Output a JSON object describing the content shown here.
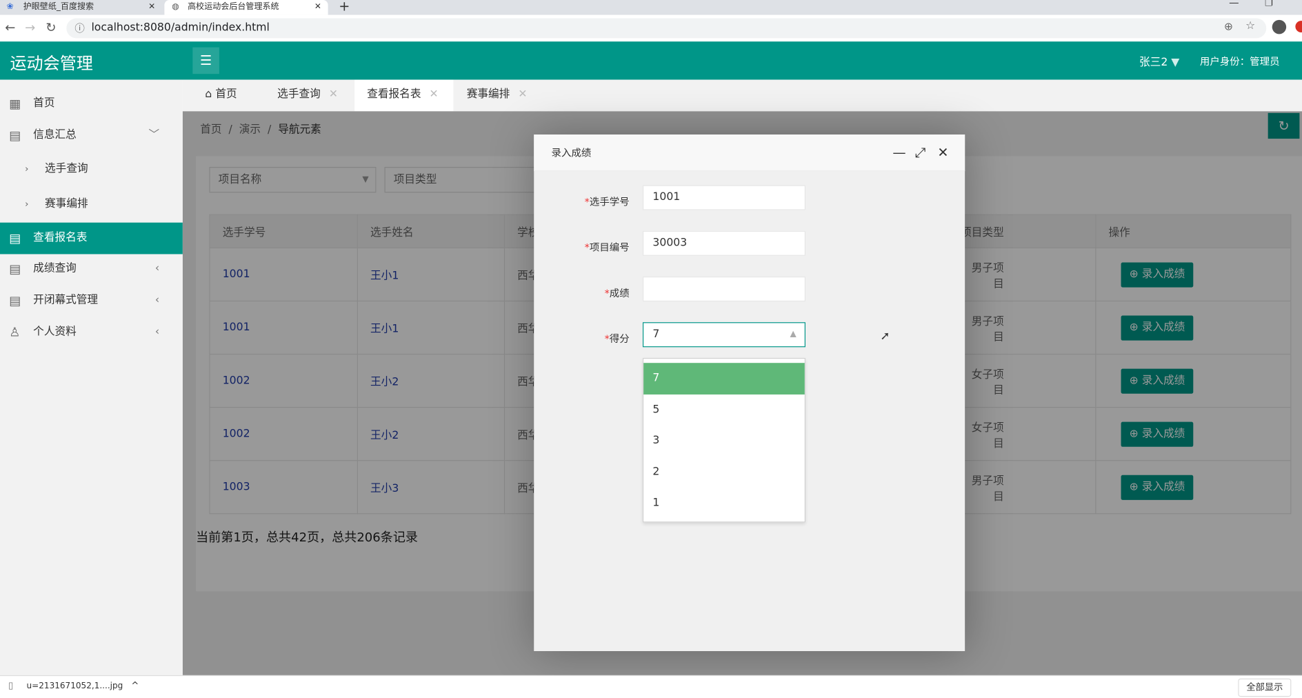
{
  "browser": {
    "tabs": [
      {
        "title": "护眼壁纸_百度搜索",
        "active": false
      },
      {
        "title": "高校运动会后台管理系统",
        "active": true
      }
    ],
    "url": "localhost:8080/admin/index.html"
  },
  "header": {
    "logo": "运动会管理",
    "user": "张三2",
    "role": "用户身份：管理员",
    "accent": "#009688"
  },
  "sidebar": {
    "items": [
      {
        "label": "首页",
        "icon": "grid-icon"
      },
      {
        "label": "信息汇总",
        "icon": "doc-icon",
        "expanded": true
      },
      {
        "label": "选手查询",
        "sub": true
      },
      {
        "label": "赛事编排",
        "sub": true
      },
      {
        "label": "查看报名表",
        "icon": "doc-icon",
        "active": true
      },
      {
        "label": "成绩查询",
        "icon": "edit-icon"
      },
      {
        "label": "开闭幕式管理",
        "icon": "doc-icon"
      },
      {
        "label": "个人资料",
        "icon": "user-icon"
      }
    ]
  },
  "page_tabs": [
    {
      "label": "首页"
    },
    {
      "label": "选手查询"
    },
    {
      "label": "查看报名表",
      "active": true
    },
    {
      "label": "赛事编排"
    }
  ],
  "breadcrumb": [
    "首页",
    "演示",
    "导航元素"
  ],
  "filters": {
    "project_name": "项目名称",
    "project_type": "项目类型"
  },
  "table": {
    "headers": [
      "选手学号",
      "选手姓名",
      "学校",
      "项目类型",
      "操作"
    ],
    "rows": [
      [
        "1001",
        "王小1",
        "西华",
        "男子项目"
      ],
      [
        "1001",
        "王小1",
        "西华",
        "男子项目"
      ],
      [
        "1002",
        "王小2",
        "西华",
        "女子项目"
      ],
      [
        "1002",
        "王小2",
        "西华",
        "女子项目"
      ],
      [
        "1003",
        "王小3",
        "西华",
        "男子项目"
      ]
    ],
    "action_label": "录入成绩"
  },
  "pagination": "当前第1页，总共42页，总共206条记录",
  "dialog": {
    "title": "录入成绩",
    "fields": [
      {
        "label": "选手学号",
        "value": "1001"
      },
      {
        "label": "项目编号",
        "value": "30003"
      },
      {
        "label": "成绩",
        "value": ""
      },
      {
        "label": "得分",
        "value": "7"
      }
    ],
    "required_mark": "*",
    "score_options": [
      "7",
      "5",
      "3",
      "2",
      "1"
    ],
    "selected_option": "7"
  },
  "downloads": {
    "file": "u=2131671052,1....jpg",
    "show_all": "全部显示"
  }
}
